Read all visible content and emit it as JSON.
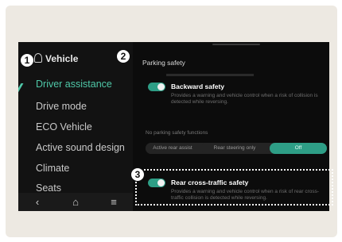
{
  "sidebar": {
    "header": "Vehicle",
    "items": [
      {
        "label": "Driver assistance",
        "active": true
      },
      {
        "label": "Drive mode",
        "active": false
      },
      {
        "label": "ECO Vehicle",
        "active": false
      },
      {
        "label": "Active sound design",
        "active": false
      },
      {
        "label": "Climate",
        "active": false
      },
      {
        "label": "Seats",
        "active": false
      }
    ],
    "bottom_nav": {
      "back": "‹",
      "home": "⌂",
      "menu": "≡"
    }
  },
  "panel": {
    "title": "Parking safety",
    "backward_safety": {
      "title": "Backward safety",
      "desc": "Provides a warning and vehicle control when a risk of collision is detected while reversing.",
      "enabled": true
    },
    "no_parking_label": "No parking safety functions",
    "segments": [
      {
        "label": "Active rear assist",
        "selected": false
      },
      {
        "label": "Rear steering only",
        "selected": false
      },
      {
        "label": "Off",
        "selected": true
      }
    ],
    "rcta": {
      "title": "Rear cross-traffic safety",
      "desc": "Provides a warning and vehicle control when a risk of rear cross-traffic collision is detected while reversing.",
      "enabled": true
    }
  },
  "callouts": [
    "1",
    "2",
    "3"
  ],
  "colors": {
    "accent": "#4fc8a8",
    "toggle_on": "#2e9e86",
    "screen_bg": "#0c0c0c"
  }
}
